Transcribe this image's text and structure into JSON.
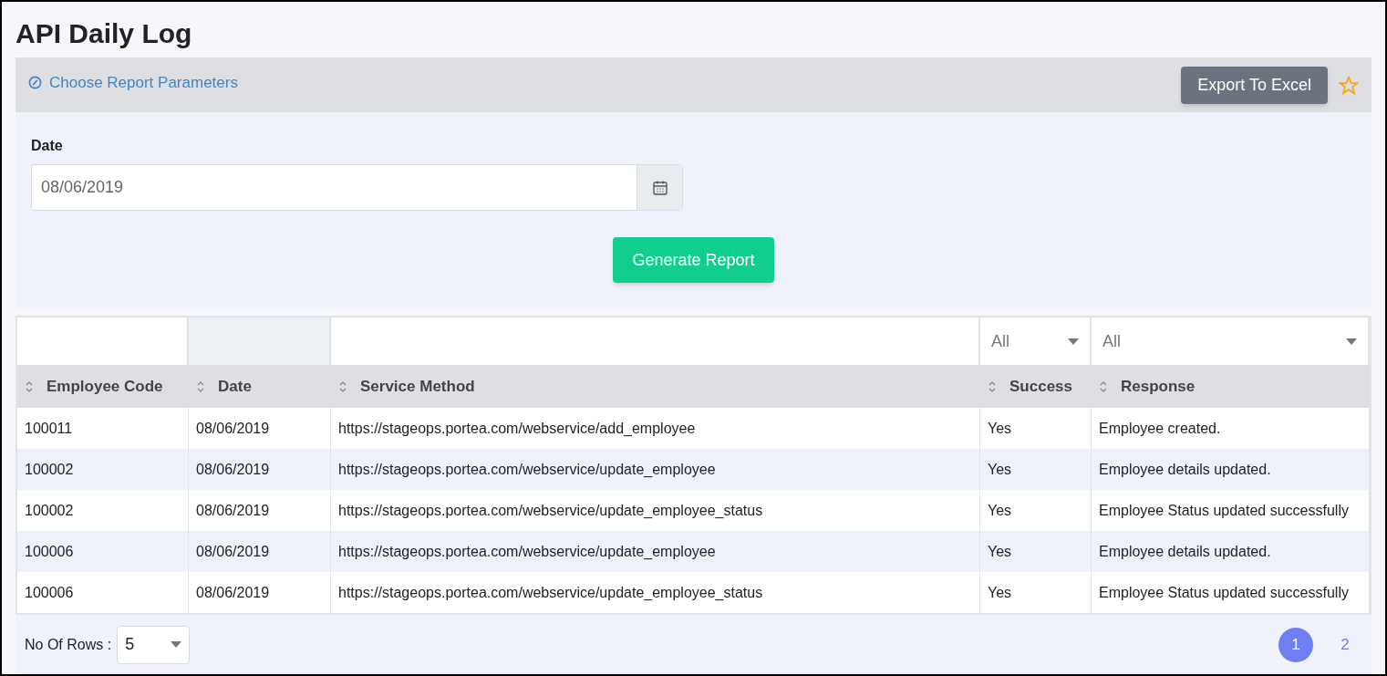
{
  "page": {
    "title": "API Daily Log"
  },
  "parameters": {
    "toggle_label": "Choose Report Parameters",
    "export_button": "Export To Excel",
    "favorite": false,
    "date_label": "Date",
    "date_value": "08/06/2019",
    "generate_button": "Generate Report"
  },
  "table": {
    "columns": [
      {
        "label": "Employee Code",
        "filter": {
          "kind": "text"
        }
      },
      {
        "label": "Date",
        "filter": {
          "kind": "disabled"
        }
      },
      {
        "label": "Service Method",
        "filter": {
          "kind": "text"
        }
      },
      {
        "label": "Success",
        "filter": {
          "kind": "select",
          "value": "All"
        }
      },
      {
        "label": "Response",
        "filter": {
          "kind": "select",
          "value": "All"
        }
      }
    ],
    "rows": [
      [
        "100011",
        "08/06/2019",
        "https://stageops.portea.com/webservice/add_employee",
        "Yes",
        "Employee created."
      ],
      [
        "100002",
        "08/06/2019",
        "https://stageops.portea.com/webservice/update_employee",
        "Yes",
        "Employee details updated."
      ],
      [
        "100002",
        "08/06/2019",
        "https://stageops.portea.com/webservice/update_employee_status",
        "Yes",
        "Employee Status updated successfully"
      ],
      [
        "100006",
        "08/06/2019",
        "https://stageops.portea.com/webservice/update_employee",
        "Yes",
        "Employee details updated."
      ],
      [
        "100006",
        "08/06/2019",
        "https://stageops.portea.com/webservice/update_employee_status",
        "Yes",
        "Employee Status updated successfully"
      ]
    ]
  },
  "footer": {
    "rows_label": "No Of Rows :",
    "rows_value": "5",
    "pages": [
      {
        "label": "1",
        "selected": true
      },
      {
        "label": "2",
        "selected": false
      }
    ]
  }
}
